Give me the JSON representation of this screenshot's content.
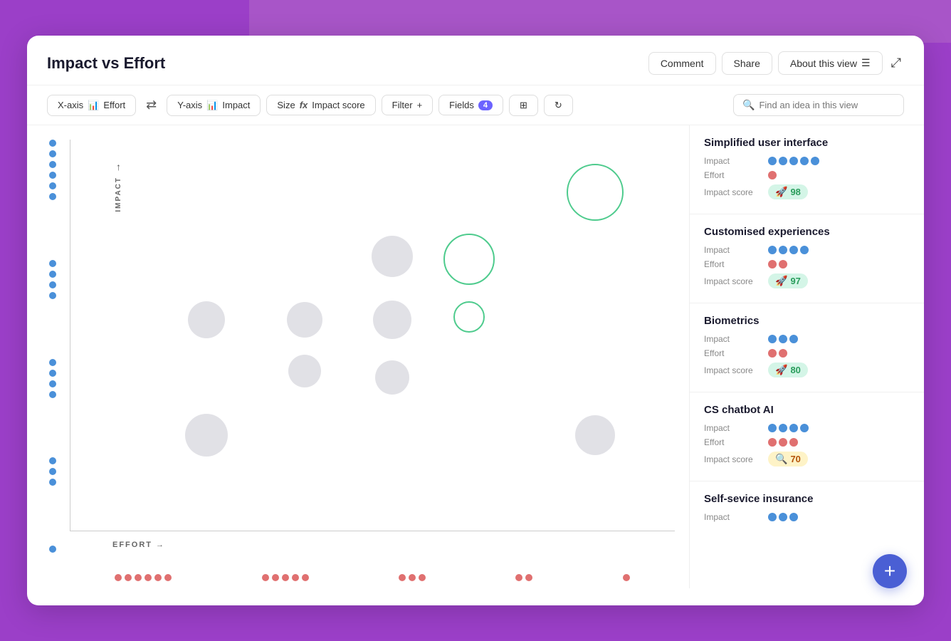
{
  "header": {
    "title": "Impact vs Effort",
    "comment_label": "Comment",
    "share_label": "Share",
    "about_label": "About this view",
    "expand_icon": "⤢"
  },
  "toolbar": {
    "xaxis_label": "X-axis",
    "xaxis_value": "Effort",
    "swap_icon": "⇄",
    "yaxis_label": "Y-axis",
    "yaxis_value": "Impact",
    "size_label": "Size",
    "size_value": "Impact score",
    "filter_label": "Filter",
    "filter_plus": "+",
    "fields_label": "Fields",
    "fields_count": "4",
    "search_placeholder": "Find an idea in this view"
  },
  "features": [
    {
      "title": "Simplified user interface",
      "impact_dots": 5,
      "effort_dots": 1,
      "score": 98,
      "score_type": "green"
    },
    {
      "title": "Customised experiences",
      "impact_dots": 4,
      "effort_dots": 2,
      "score": 97,
      "score_type": "green"
    },
    {
      "title": "Biometrics",
      "impact_dots": 3,
      "effort_dots": 2,
      "score": 80,
      "score_type": "green"
    },
    {
      "title": "CS chatbot AI",
      "impact_dots": 4,
      "effort_dots": 3,
      "score": 70,
      "score_type": "yellow"
    },
    {
      "title": "Self-sevice insurance",
      "impact_dots": 3,
      "effort_dots": 0,
      "score": null,
      "score_type": "green"
    }
  ],
  "axis": {
    "x_label": "EFFORT →",
    "y_label": "IMPACT"
  },
  "add_button_label": "+"
}
